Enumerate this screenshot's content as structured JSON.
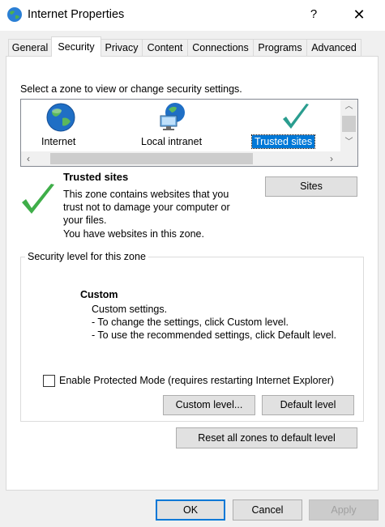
{
  "window": {
    "title": "Internet Properties",
    "help_glyph": "?",
    "close_glyph": "✕"
  },
  "tabs": [
    {
      "label": "General",
      "active": false
    },
    {
      "label": "Security",
      "active": true
    },
    {
      "label": "Privacy",
      "active": false
    },
    {
      "label": "Content",
      "active": false
    },
    {
      "label": "Connections",
      "active": false
    },
    {
      "label": "Programs",
      "active": false
    },
    {
      "label": "Advanced",
      "active": false
    }
  ],
  "security": {
    "zone_prompt": "Select a zone to view or change security settings.",
    "zones": [
      {
        "label": "Internet",
        "icon": "globe-icon",
        "selected": false
      },
      {
        "label": "Local intranet",
        "icon": "network-globe-icon",
        "selected": false
      },
      {
        "label": "Trusted sites",
        "icon": "checkmark-icon",
        "selected": true
      }
    ],
    "zone_info": {
      "title": "Trusted sites",
      "lines": [
        "This zone contains websites that you",
        "trust not to damage your computer or",
        "your files.",
        "You have websites in this zone."
      ],
      "sites_button": "Sites"
    },
    "level_group": {
      "title": "Security level for this zone",
      "level_name": "Custom",
      "lines": [
        "Custom settings.",
        "- To change the settings, click Custom level.",
        "- To use the recommended settings, click Default level."
      ],
      "protected_mode_label": "Enable Protected Mode (requires restarting Internet Explorer)",
      "protected_mode_checked": false,
      "custom_level_button": "Custom level...",
      "default_level_button": "Default level"
    },
    "reset_all_button": "Reset all zones to default level"
  },
  "footer": {
    "ok": "OK",
    "cancel": "Cancel",
    "apply": "Apply"
  },
  "colors": {
    "accent": "#0078d7",
    "check_green": "#3fae49",
    "trusted_check_teal": "#2a9d8f"
  }
}
